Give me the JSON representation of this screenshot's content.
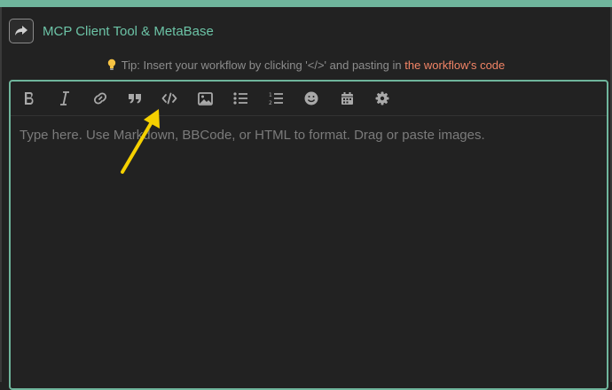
{
  "topic": {
    "title": "MCP Client Tool & MetaBase"
  },
  "tip": {
    "prefix": "Tip: Insert your workflow by clicking '</>' and pasting in",
    "link": "the workflow's code"
  },
  "toolbar": {
    "buttons": [
      {
        "name": "bold",
        "icon": "bold-icon"
      },
      {
        "name": "italic",
        "icon": "italic-icon"
      },
      {
        "name": "link",
        "icon": "link-icon"
      },
      {
        "name": "quote",
        "icon": "quote-icon"
      },
      {
        "name": "preformatted-code",
        "icon": "code-icon"
      },
      {
        "name": "image",
        "icon": "image-icon"
      },
      {
        "name": "bullet-list",
        "icon": "bullet-list-icon"
      },
      {
        "name": "numbered-list",
        "icon": "numbered-list-icon"
      },
      {
        "name": "emoji",
        "icon": "emoji-icon"
      },
      {
        "name": "insert-date",
        "icon": "calendar-icon"
      },
      {
        "name": "options",
        "icon": "gear-icon"
      }
    ]
  },
  "editor": {
    "placeholder": "Type here. Use Markdown, BBCode, or HTML to format. Drag or paste images."
  },
  "colors": {
    "accent": "#6fb59c",
    "title": "#6cc3a6",
    "link": "#f28466",
    "annotation_arrow": "#f5d000"
  }
}
